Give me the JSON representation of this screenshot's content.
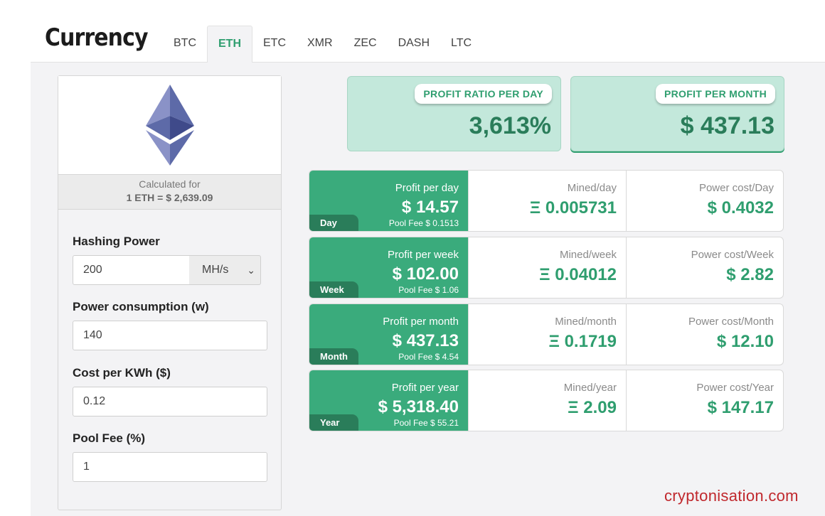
{
  "header": {
    "title": "Currency",
    "tabs": [
      {
        "label": "BTC"
      },
      {
        "label": "ETH",
        "active": true
      },
      {
        "label": "ETC"
      },
      {
        "label": "XMR"
      },
      {
        "label": "ZEC"
      },
      {
        "label": "DASH"
      },
      {
        "label": "LTC"
      }
    ]
  },
  "left_panel": {
    "coin_icon": "ethereum-icon",
    "calculated_for_label": "Calculated for",
    "calculated_for_value": "1 ETH = $ 2,639.09",
    "hashing_power": {
      "label": "Hashing Power",
      "value": "200",
      "unit": "MH/s"
    },
    "power_consumption": {
      "label": "Power consumption (w)",
      "value": "140"
    },
    "cost_per_kwh": {
      "label": "Cost per KWh ($)",
      "value": "0.12"
    },
    "pool_fee": {
      "label": "Pool Fee (%)",
      "value": "1"
    }
  },
  "summary": {
    "ratio": {
      "label": "PROFIT RATIO PER DAY",
      "value": "3,613%"
    },
    "month": {
      "label": "PROFIT PER MONTH",
      "value": "$ 437.13"
    }
  },
  "periods": [
    {
      "tag": "Day",
      "profit_label": "Profit per day",
      "profit": "$ 14.57",
      "pool_fee": "Pool Fee $ 0.1513",
      "mined_label": "Mined/day",
      "mined": "Ξ 0.005731",
      "power_label": "Power cost/Day",
      "power": "$ 0.4032"
    },
    {
      "tag": "Week",
      "profit_label": "Profit per week",
      "profit": "$ 102.00",
      "pool_fee": "Pool Fee $ 1.06",
      "mined_label": "Mined/week",
      "mined": "Ξ 0.04012",
      "power_label": "Power cost/Week",
      "power": "$ 2.82"
    },
    {
      "tag": "Month",
      "profit_label": "Profit per month",
      "profit": "$ 437.13",
      "pool_fee": "Pool Fee $ 4.54",
      "mined_label": "Mined/month",
      "mined": "Ξ 0.1719",
      "power_label": "Power cost/Month",
      "power": "$ 12.10"
    },
    {
      "tag": "Year",
      "profit_label": "Profit per year",
      "profit": "$ 5,318.40",
      "pool_fee": "Pool Fee $ 55.21",
      "mined_label": "Mined/year",
      "mined": "Ξ 2.09",
      "power_label": "Power cost/Year",
      "power": "$ 147.17"
    }
  ],
  "watermark": "cryptonisation.com",
  "colors": {
    "accent": "#3aab7c",
    "accent_dark": "#2a7d5a",
    "summary_bg": "#c3e8db",
    "watermark": "#c0282d"
  }
}
